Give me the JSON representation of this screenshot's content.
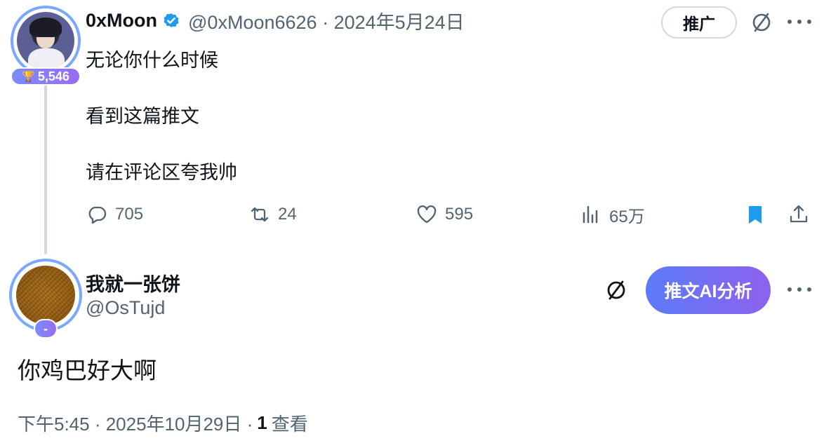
{
  "tweet": {
    "author": {
      "name": "0xMoon",
      "handle": "@0xMoon6626",
      "date": "2024年5月24日",
      "score": "5,546",
      "verified_color": "#1d9bf0"
    },
    "promote_label": "推广",
    "lines": [
      "无论你什么时候",
      "看到这篇推文",
      "请在评论区夸我帅"
    ],
    "stats": {
      "replies": "705",
      "retweets": "24",
      "likes": "595",
      "views": "65万"
    },
    "bookmark_color": "#1d9bf0"
  },
  "reply": {
    "author": {
      "name": "我就一张饼",
      "handle": "@OsTujd",
      "badge": "-"
    },
    "ai_button_label": "推文AI分析",
    "text": "你鸡巴好大啊",
    "time": "下午5:45 · 2025年10月29日 · ",
    "views_count": "1",
    "views_label": "查看"
  },
  "colors": {
    "accent_gradient_start": "#5b7bf8",
    "accent_gradient_end": "#8e61ee",
    "secondary_text": "#536471",
    "primary_text": "#0f1419"
  },
  "icons": [
    "verified-badge-icon",
    "slash-circle-icon",
    "more-icon",
    "reply-icon",
    "retweet-icon",
    "like-icon",
    "views-icon",
    "bookmark-icon",
    "share-icon",
    "trophy-icon"
  ]
}
